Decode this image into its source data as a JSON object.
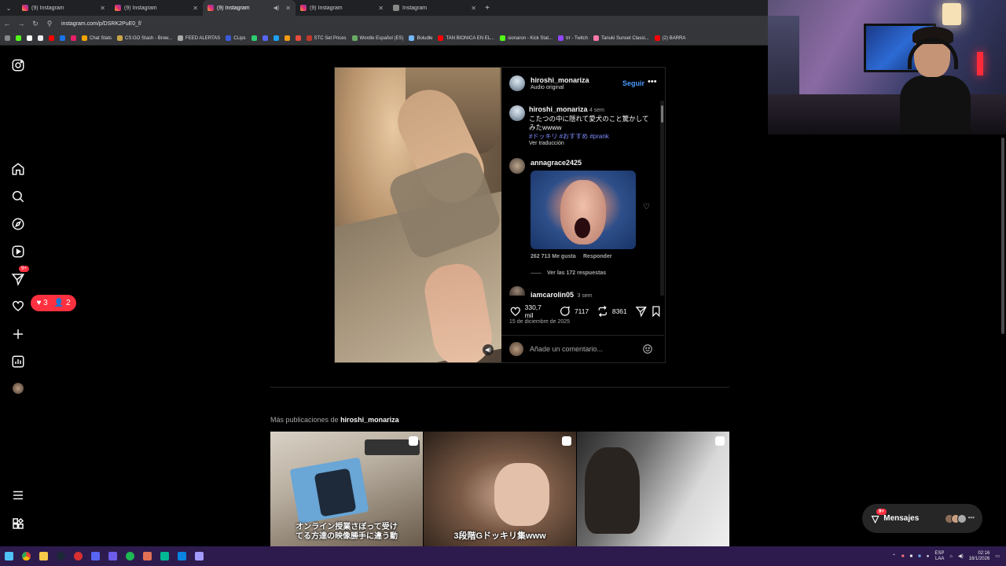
{
  "browser": {
    "tabs": [
      {
        "title": "(9) Instagram",
        "active": false
      },
      {
        "title": "(9) Instagram",
        "active": false
      },
      {
        "title": "(9) Instagram",
        "active": true
      },
      {
        "title": "(9) Instagram",
        "active": false
      },
      {
        "title": "Instagram",
        "active": false
      }
    ],
    "url": "instagram.com/p/DSRK2PuE0_f/",
    "bookmarks": [
      "Chat Stats",
      "CS:GO Stash - Brow...",
      "FEED ALERTAS",
      "CLips",
      "STC Set Prices",
      "Wordle Español (ES)",
      "Boludle",
      "TAN BIONICA EN EL...",
      "sionaron - Kick Stat...",
      "trr - Twitch",
      "Tanuki Sunset Classi...",
      "(2) BARRA"
    ]
  },
  "sidebar": {
    "notifications_badge": "9+",
    "likes_count": "3",
    "follows_count": "2"
  },
  "post": {
    "username": "hiroshi_monariza",
    "audio": "Audio original",
    "follow_label": "Seguir",
    "caption": {
      "username": "hiroshi_monariza",
      "time": "4 sem",
      "text_line1": "こたつの中に隠れて愛犬のこと驚かして",
      "text_line2": "みたwwww",
      "hashtags": "#ドッキリ #おすすめ #prank",
      "translate": "Ver traducción"
    },
    "comments": [
      {
        "username": "annagrace2425",
        "likes": "262 713 Me gusta",
        "reply": "Responder",
        "replies": "Ver las 172 respuestas"
      },
      {
        "username": "iamcarolin05",
        "time": "3 sem"
      }
    ],
    "likes": "330,7 mil",
    "comments_count": "7117",
    "reposts": "8361",
    "date": "15 de diciembre de 2025",
    "comment_placeholder": "Añade un comentario..."
  },
  "more": {
    "prefix": "Más publicaciones de ",
    "username": "hiroshi_monariza",
    "thumbs": [
      {
        "caption_line1": "オンライン授業さぼって受け",
        "caption_line2": "てる方達の映像勝手に違う動"
      },
      {
        "caption_line1": "3段階Gドッキリ集www",
        "caption_line2": ""
      },
      {
        "caption_line1": "",
        "caption_line2": ""
      }
    ]
  },
  "messages": {
    "label": "Mensajes",
    "badge": "9+"
  },
  "taskbar": {
    "lang_line1": "ESP",
    "lang_line2": "LAA",
    "time": "02:16",
    "date": "16/1/2026"
  }
}
